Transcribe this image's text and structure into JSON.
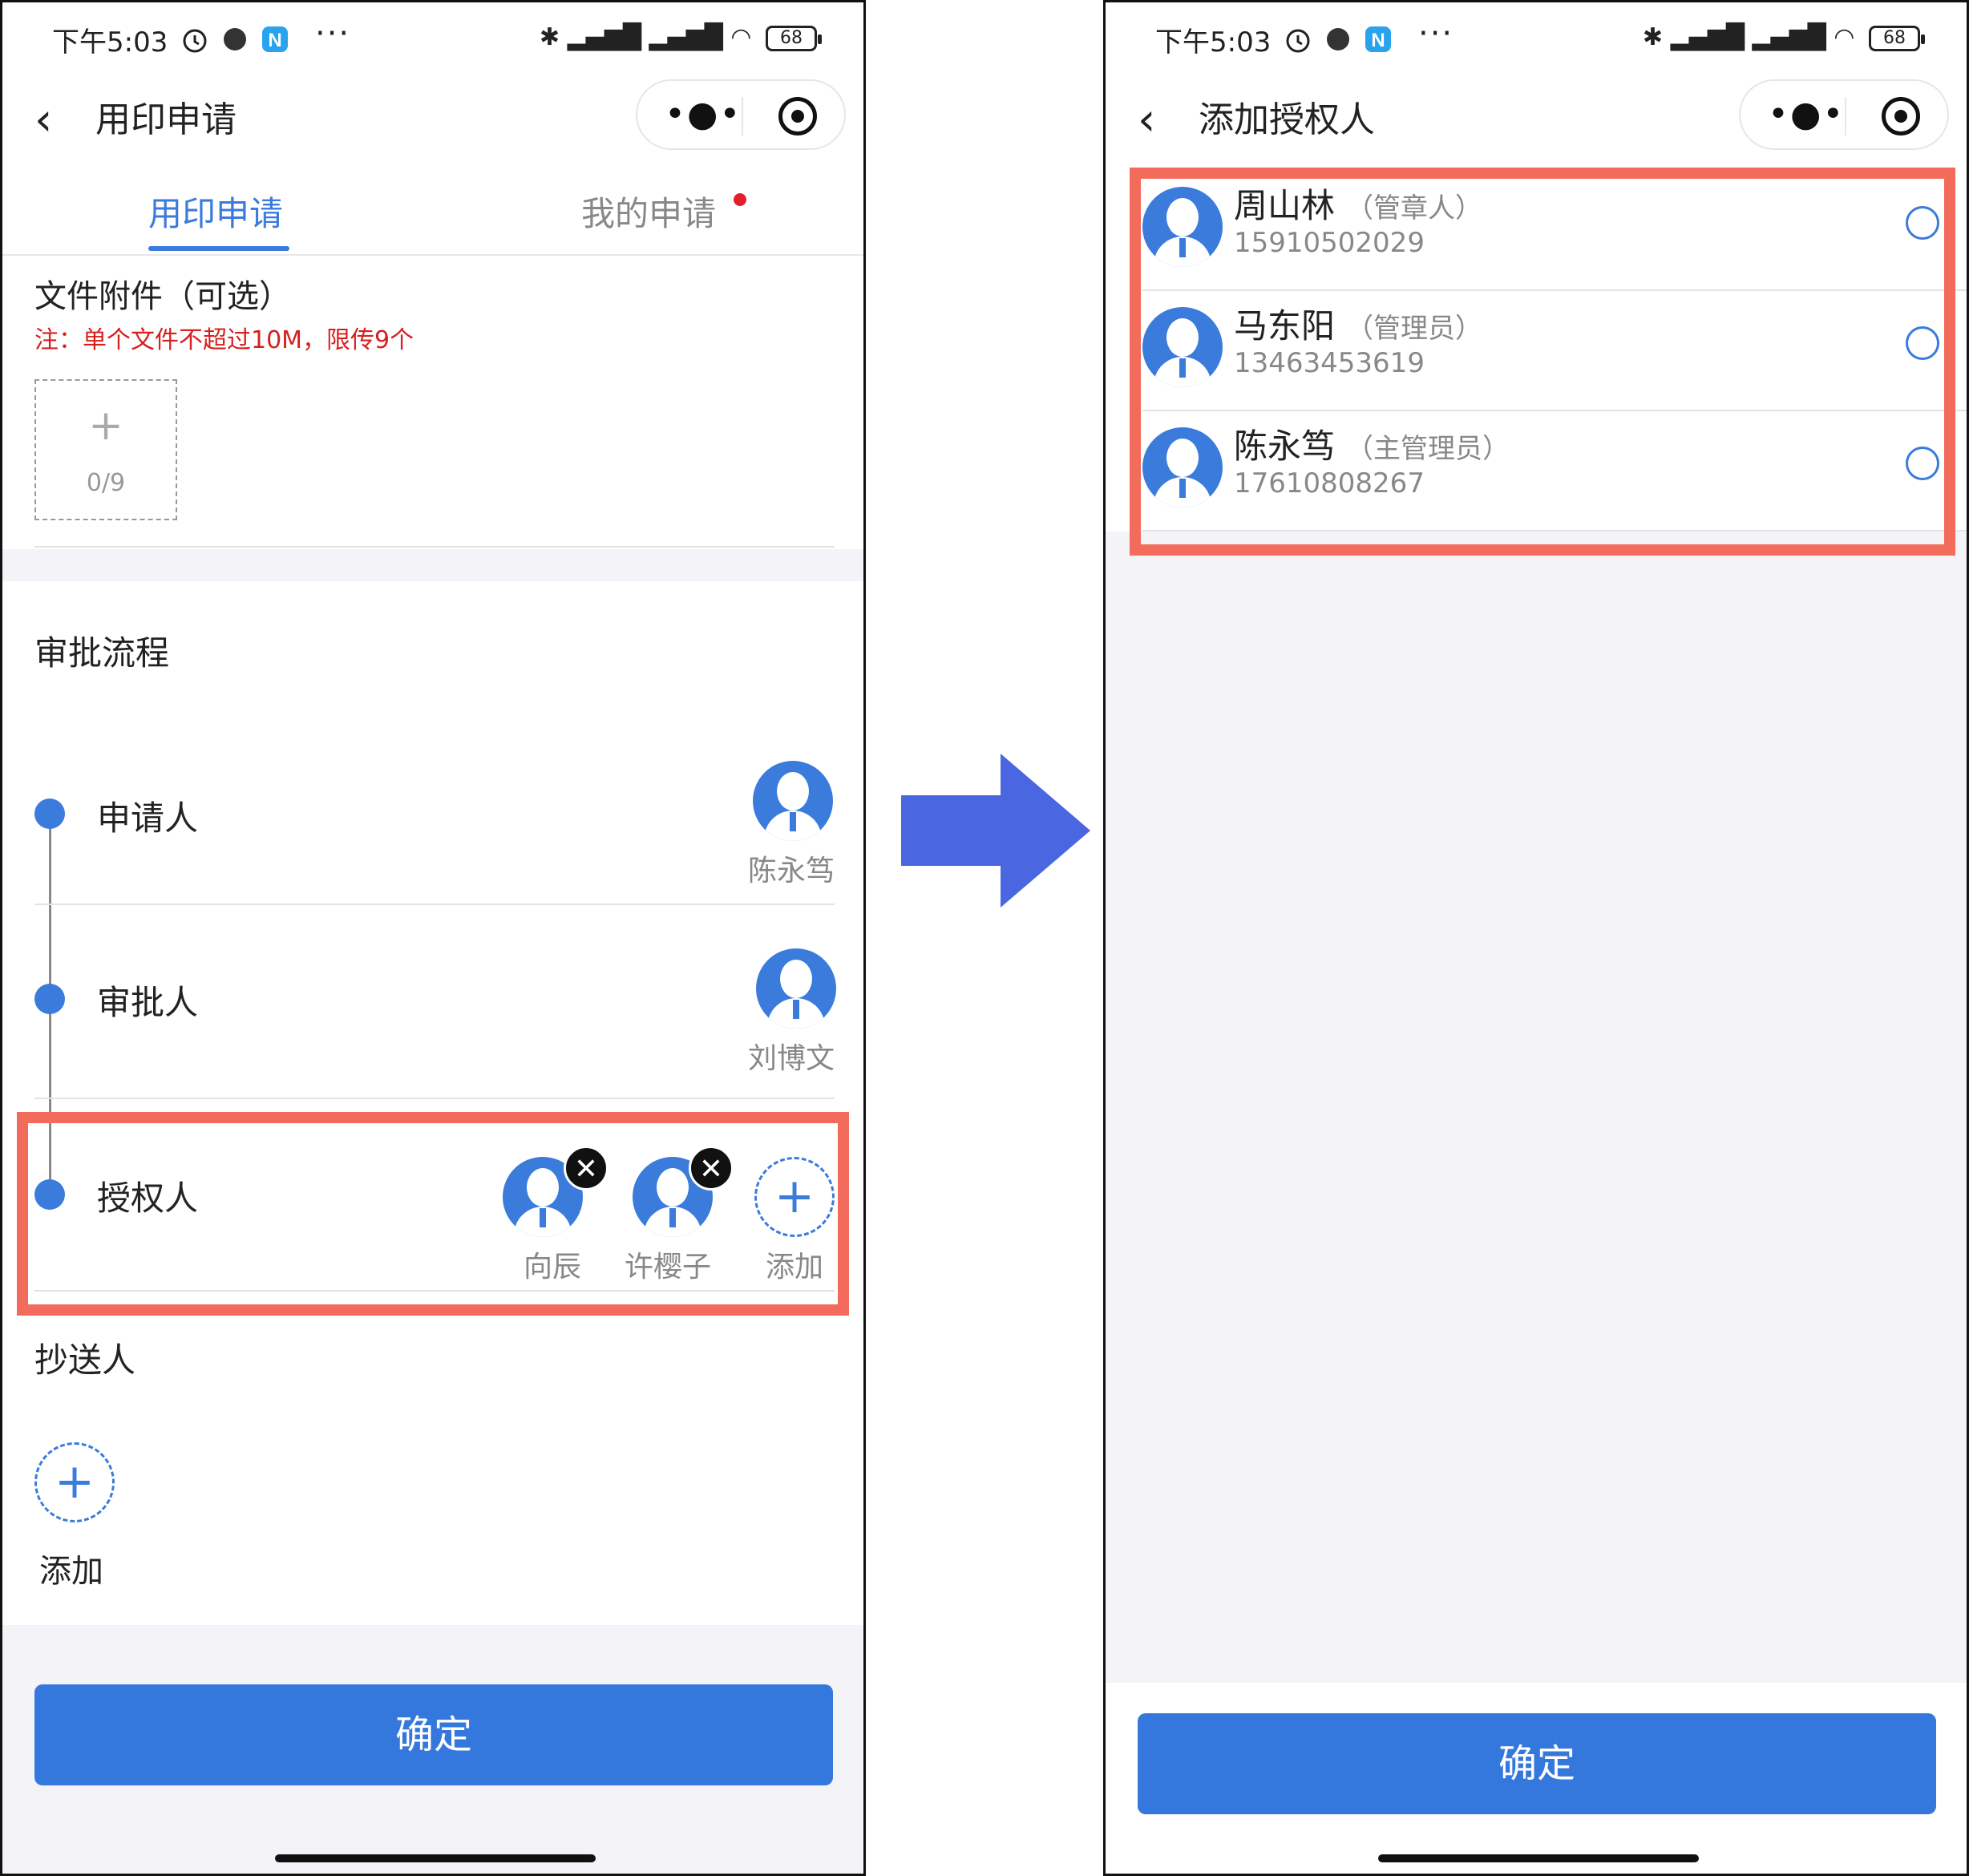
{
  "status_bar": {
    "time": "下午5:03",
    "battery": "68",
    "icons": [
      "alarm-icon",
      "record-icon",
      "app-n-icon",
      "bluetooth-icon",
      "signal-icon",
      "wifi-icon"
    ]
  },
  "left": {
    "nav": {
      "title": "用印申请"
    },
    "tabs": [
      {
        "label": "用印申请",
        "active": true
      },
      {
        "label": "我的申请",
        "active": false,
        "badge": "red-dot"
      }
    ],
    "attachments": {
      "title": "文件附件（可选）",
      "note": "注：单个文件不超过10M，限传9个",
      "plus": "+",
      "count": "0/9"
    },
    "approval": {
      "title": "审批流程",
      "applicant": {
        "label": "申请人",
        "name": "陈永笃"
      },
      "approver": {
        "label": "审批人",
        "name": "刘博文"
      },
      "authorizer": {
        "label": "授权人",
        "people": [
          "向辰",
          "许樱子"
        ],
        "add_label": "添加"
      }
    },
    "cc": {
      "label": "抄送人",
      "add_label": "添加"
    },
    "confirm": "确定"
  },
  "right": {
    "nav": {
      "title": "添加授权人"
    },
    "people": [
      {
        "name": "周山林",
        "role": "（管章人）",
        "phone": "15910502029"
      },
      {
        "name": "马东阳",
        "role": "（管理员）",
        "phone": "13463453619"
      },
      {
        "name": "陈永笃",
        "role": "（主管理员）",
        "phone": "17610808267"
      }
    ],
    "confirm": "确定"
  },
  "colors": {
    "accent": "#3a7bdc",
    "highlight": "#f26b5b",
    "arrow": "#4a66e0",
    "warning": "#d6201e"
  }
}
